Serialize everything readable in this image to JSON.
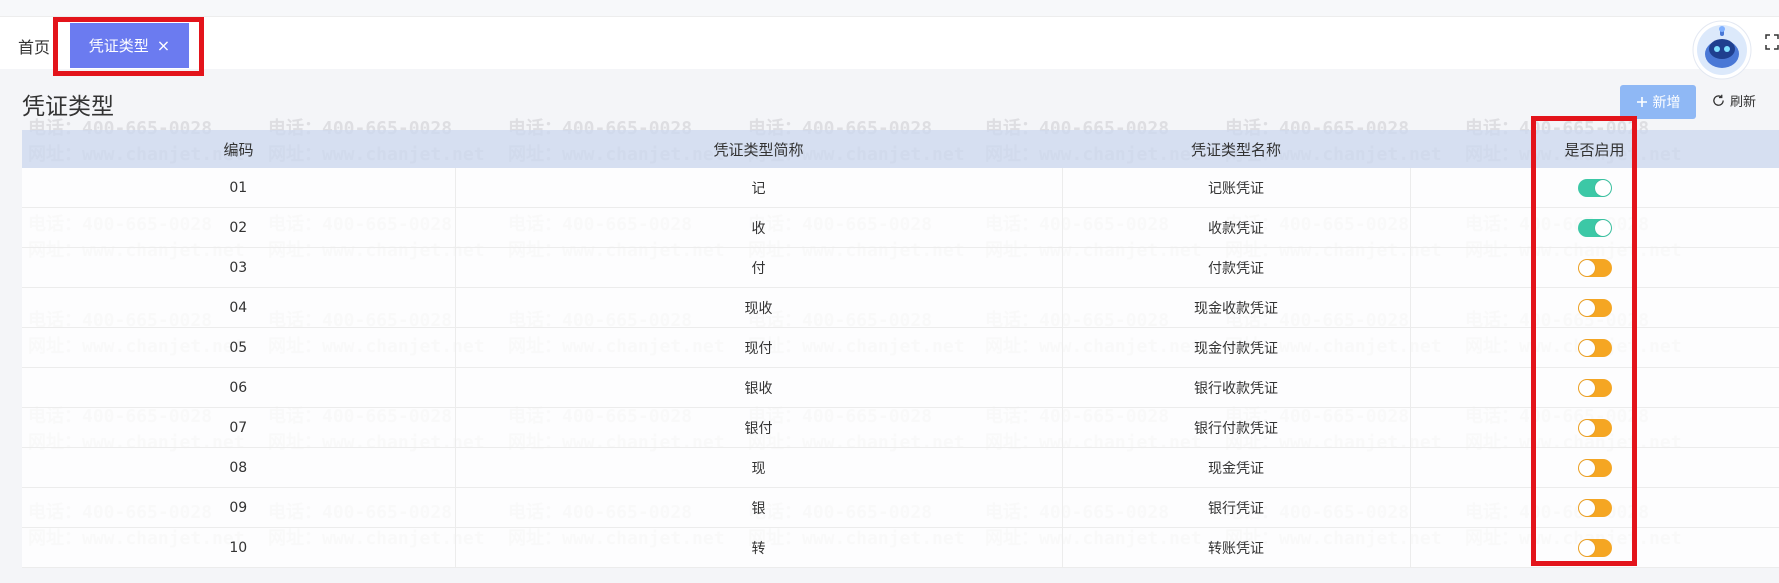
{
  "tabs": {
    "home_label": "首页",
    "active_label": "凭证类型",
    "close_glyph": "×"
  },
  "page": {
    "title": "凭证类型"
  },
  "toolbar": {
    "add_label": "新增",
    "refresh_label": "刷新"
  },
  "watermark": {
    "line1": "电话：400-665-0028",
    "line2": "网址：www.chanjet.net"
  },
  "table": {
    "headers": [
      "编码",
      "凭证类型简称",
      "凭证类型名称",
      "是否启用"
    ],
    "rows": [
      {
        "code": "01",
        "short": "记",
        "name": "记账凭证",
        "enabled": true
      },
      {
        "code": "02",
        "short": "收",
        "name": "收款凭证",
        "enabled": true
      },
      {
        "code": "03",
        "short": "付",
        "name": "付款凭证",
        "enabled": false
      },
      {
        "code": "04",
        "short": "现收",
        "name": "现金收款凭证",
        "enabled": false
      },
      {
        "code": "05",
        "short": "现付",
        "name": "现金付款凭证",
        "enabled": false
      },
      {
        "code": "06",
        "short": "银收",
        "name": "银行收款凭证",
        "enabled": false
      },
      {
        "code": "07",
        "short": "银付",
        "name": "银行付款凭证",
        "enabled": false
      },
      {
        "code": "08",
        "short": "现",
        "name": "现金凭证",
        "enabled": false
      },
      {
        "code": "09",
        "short": "银",
        "name": "银行凭证",
        "enabled": false
      },
      {
        "code": "10",
        "short": "转",
        "name": "转账凭证",
        "enabled": false
      }
    ]
  },
  "colors": {
    "tab_active_bg": "#6b7bf0",
    "toggle_on": "#3cc8a6",
    "toggle_off": "#f5a623",
    "highlight": "#e3141b",
    "add_button_bg": "#8fb8f5"
  },
  "icons": {
    "add": "plus-icon",
    "refresh": "refresh-icon",
    "close": "close-icon",
    "avatar": "robot-avatar-icon",
    "fullscreen": "fullscreen-icon"
  }
}
